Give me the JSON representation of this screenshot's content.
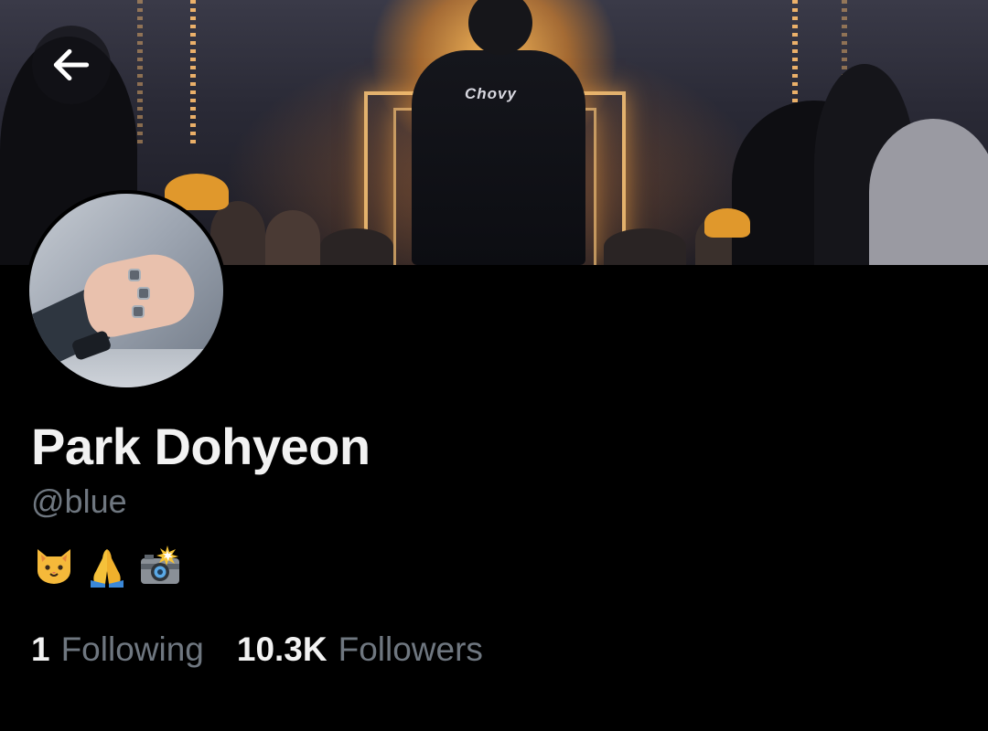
{
  "profile": {
    "display_name": "Park Dohyeon",
    "handle": "@blue",
    "bio_emojis": [
      "cat-face",
      "folded-hands",
      "camera-with-flash"
    ]
  },
  "stats": {
    "following_count": "1",
    "following_label": "Following",
    "followers_count": "10.3K",
    "followers_label": "Followers"
  },
  "banner": {
    "jersey_text": "Chovy"
  },
  "icons": {
    "back": "arrow-left-icon"
  }
}
